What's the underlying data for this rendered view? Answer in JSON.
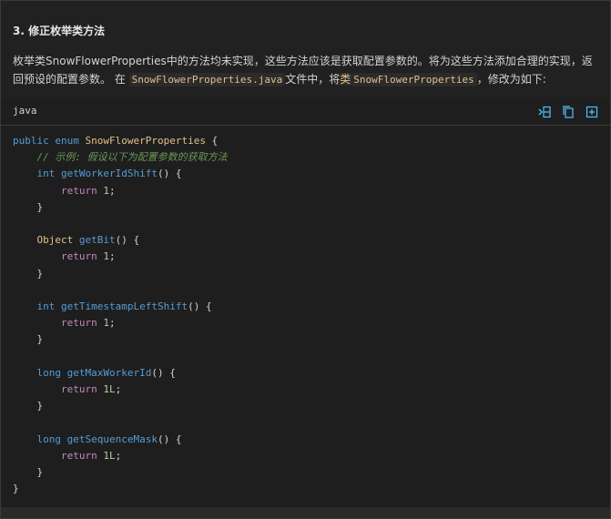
{
  "section": {
    "heading": "3. 修正枚举类方法"
  },
  "paragraph": {
    "text_1": "枚举类SnowFlowerProperties中的方法均未实现，这些方法应该是获取配置参数的。将为这些方法添加合理的实现，返回预设的配置参数。 在",
    "file_code": "SnowFlowerProperties.java",
    "text_2": "文件中，将",
    "class_prefix": "类",
    "class_code": "SnowFlowerProperties",
    "text_3": "，修改为如下:"
  },
  "code_block": {
    "language": "java",
    "tools": {
      "expand_icon": "insert-at-cursor-icon",
      "copy_icon": "copy-icon",
      "new_file_icon": "new-file-icon"
    },
    "lines": {
      "l1_kw": "public enum",
      "l1_type": "SnowFlowerProperties",
      "l1_rest": " {",
      "l2_comment": "// 示例: 假设以下为配置参数的获取方法",
      "m1_type": "int",
      "m1_name": "getWorkerIdShift",
      "m1_val": "1",
      "m2_type": "Object",
      "m2_name": "getBit",
      "m2_val": "1",
      "m3_type": "int",
      "m3_name": "getTimestampLeftShift",
      "m3_val": "1",
      "m4_type": "long",
      "m4_name": "getMaxWorkerId",
      "m4_val": "1L",
      "m5_type": "long",
      "m5_name": "getSequenceMask",
      "m5_val": "1L",
      "return_kw": "return",
      "open_paren": "() {",
      "close_brace": "}",
      "end_brace": "}"
    }
  },
  "colors": {
    "background": "#212121",
    "keyword": "#569cd6",
    "type": "#e2c08d",
    "number": "#b5cea8",
    "comment": "#6a9955",
    "accent_icon": "#4fc1ff"
  }
}
